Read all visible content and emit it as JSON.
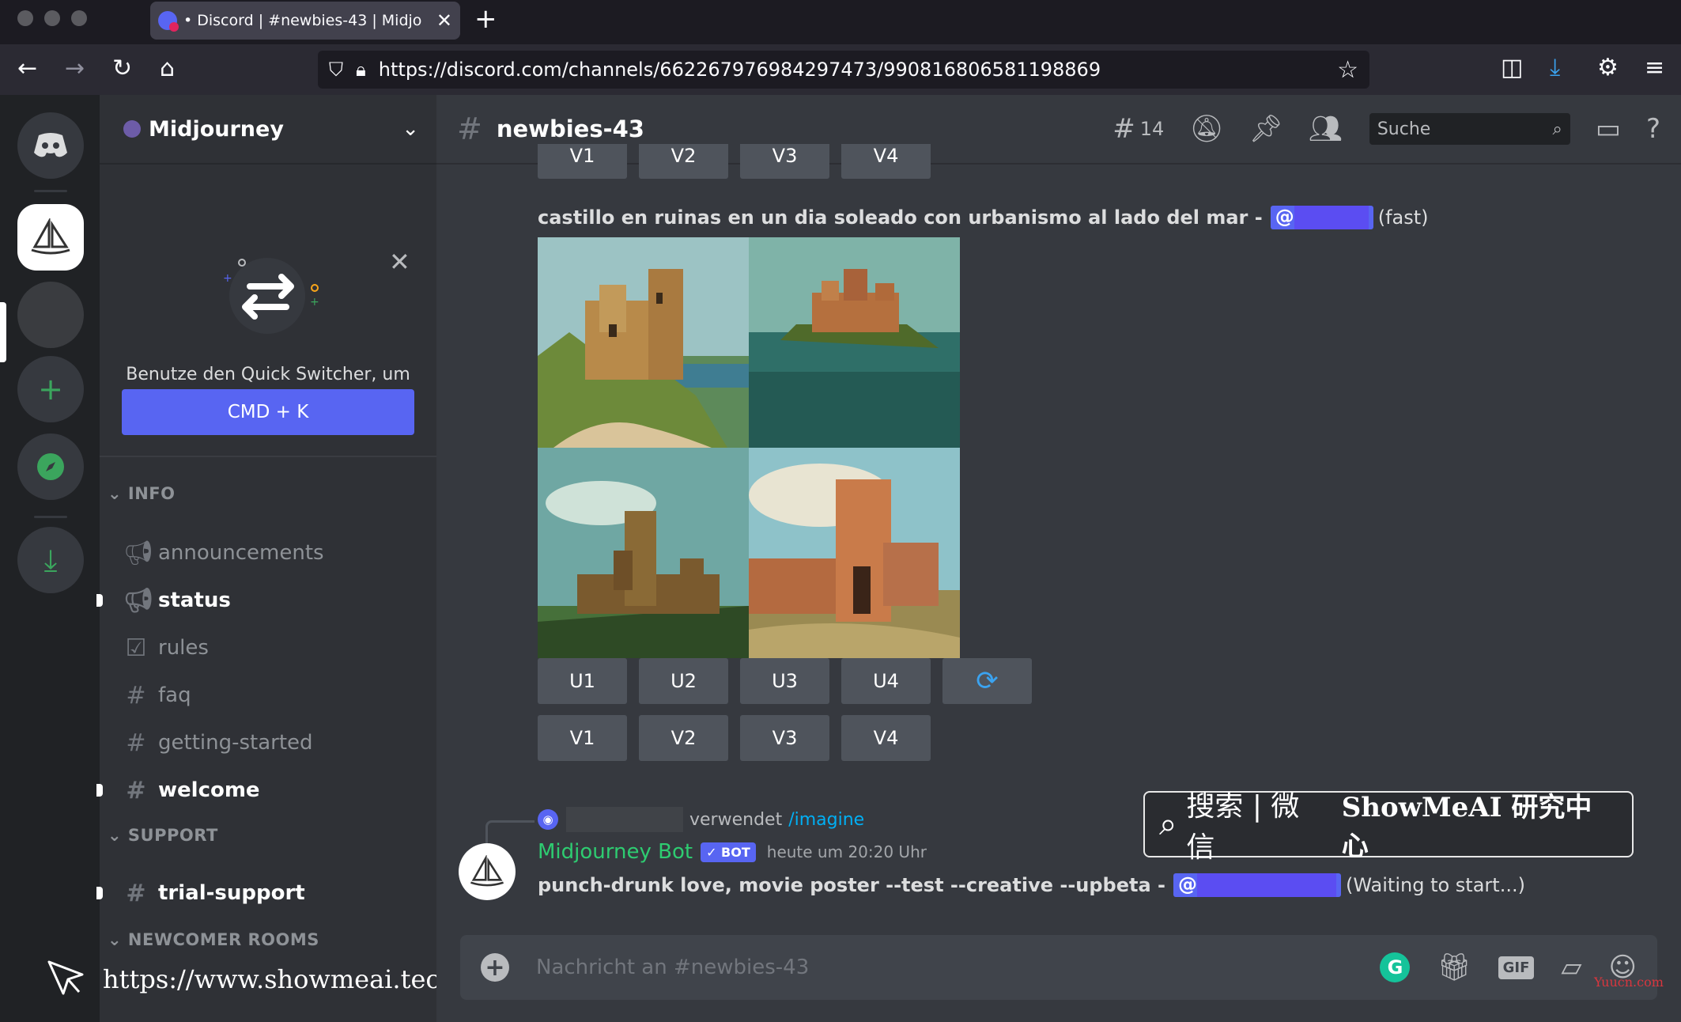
{
  "browser": {
    "tab_title": "• Discord | #newbies-43 | Midjo",
    "url": "https://discord.com/channels/662267976984297473/990816806581198869"
  },
  "guild": {
    "name": "Midjourney"
  },
  "quick_switcher": {
    "text": "Benutze den Quick Switcher, um in Discord schnell zu navigieren. Drücke einfach:",
    "shortcut": "CMD + K"
  },
  "categories": {
    "info": "INFO",
    "support": "SUPPORT",
    "newcomer": "NEWCOMER ROOMS"
  },
  "channels": [
    {
      "label": "announcements",
      "icon": "megaphone-icon"
    },
    {
      "label": "status",
      "icon": "megaphone-icon"
    },
    {
      "label": "rules",
      "icon": "checkbox-icon"
    },
    {
      "label": "faq",
      "icon": "hash-icon"
    },
    {
      "label": "getting-started",
      "icon": "hash-icon"
    },
    {
      "label": "welcome",
      "icon": "hash-thread-icon"
    },
    {
      "label": "trial-support",
      "icon": "hash-icon"
    }
  ],
  "watermark": {
    "url": "https://www.showmeai.tech",
    "search_label": "搜索 | 微信",
    "brand": "ShowMeAI 研究中心",
    "corner": "Yuucn.com"
  },
  "channel_header": {
    "name": "newbies-43",
    "threads_count": "14",
    "search_placeholder": "Suche"
  },
  "message1": {
    "prompt": "castillo en ruinas en un dia soleado con urbanismo al lado del mar -",
    "mention_prefix": "@",
    "status": "(fast)",
    "upscale_buttons": [
      "U1",
      "U2",
      "U3",
      "U4"
    ],
    "variation_buttons": [
      "V1",
      "V2",
      "V3",
      "V4"
    ]
  },
  "message2": {
    "reply_action": "verwendet",
    "reply_command": "/imagine",
    "username": "Midjourney Bot",
    "bot_badge": "✓ BOT",
    "timestamp": "heute um 20:20 Uhr",
    "prompt": "punch-drunk love, movie poster --test --creative --upbeta -",
    "mention_prefix": "@",
    "status": "(Waiting to start...)"
  },
  "composer": {
    "placeholder": "Nachricht an #newbies-43"
  },
  "colors": {
    "blurple": "#5865f2",
    "bot_green": "#2ecc71",
    "link_blue": "#00aff4"
  }
}
